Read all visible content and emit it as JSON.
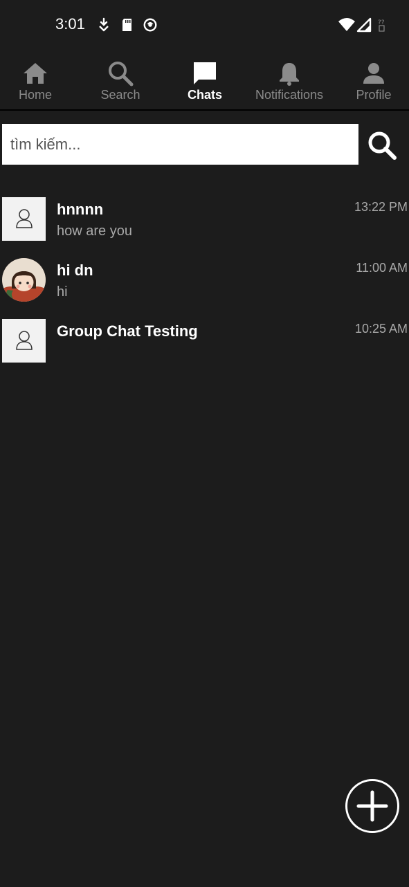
{
  "status_bar": {
    "time": "3:01",
    "icons": [
      "download-arrow-icon",
      "sd-card-icon",
      "app-status-icon",
      "wifi-icon",
      "cell-signal-icon",
      "no-sim-icon"
    ]
  },
  "nav": {
    "tabs": [
      {
        "label": "Home",
        "icon": "home-icon"
      },
      {
        "label": "Search",
        "icon": "search-icon"
      },
      {
        "label": "Chats",
        "icon": "chat-bubble-icon",
        "active": true
      },
      {
        "label": "Notifications",
        "icon": "bell-icon"
      },
      {
        "label": "Profile",
        "icon": "person-icon"
      }
    ]
  },
  "search": {
    "placeholder": "tìm kiếm...",
    "value": ""
  },
  "chats": [
    {
      "name": "hnnnn",
      "last_message": "how are you",
      "time": "13:22 PM",
      "avatar": "default-avatar-icon"
    },
    {
      "name": "hi dn",
      "last_message": "hi",
      "time": "11:00 AM",
      "avatar": "user-photo"
    },
    {
      "name": "Group Chat Testing",
      "last_message": "",
      "time": "10:25 AM",
      "avatar": "default-avatar-icon"
    }
  ],
  "fab": {
    "icon": "plus-icon"
  },
  "colors": {
    "background": "#1c1c1c",
    "text_primary": "#ffffff",
    "text_secondary": "#a8a8a8",
    "nav_inactive": "#8b8b8b"
  }
}
